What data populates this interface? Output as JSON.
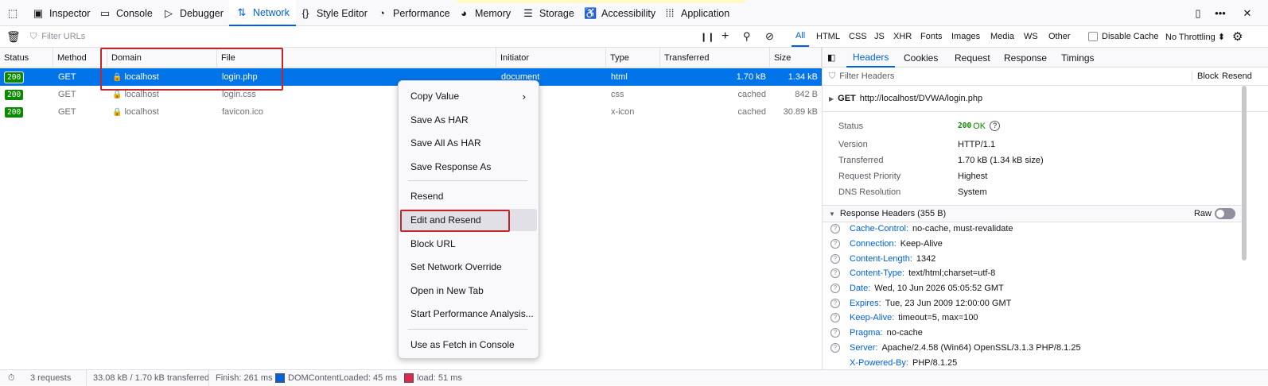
{
  "toolbar": {
    "tabs": [
      {
        "label": "Inspector",
        "icon": "inspector-icon"
      },
      {
        "label": "Console",
        "icon": "console-icon"
      },
      {
        "label": "Debugger",
        "icon": "debugger-icon"
      },
      {
        "label": "Network",
        "icon": "network-icon",
        "active": true
      },
      {
        "label": "Style Editor",
        "icon": "style-editor-icon"
      },
      {
        "label": "Performance",
        "icon": "performance-icon"
      },
      {
        "label": "Memory",
        "icon": "memory-icon"
      },
      {
        "label": "Storage",
        "icon": "storage-icon"
      },
      {
        "label": "Accessibility",
        "icon": "accessibility-icon"
      },
      {
        "label": "Application",
        "icon": "application-icon"
      }
    ]
  },
  "filterbar": {
    "placeholder": "Filter URLs",
    "types": [
      "All",
      "HTML",
      "CSS",
      "JS",
      "XHR",
      "Fonts",
      "Images",
      "Media",
      "WS",
      "Other"
    ],
    "active_type": "All",
    "disable_cache_label": "Disable Cache",
    "throttling_label": "No Throttling ⬍"
  },
  "request_table": {
    "columns": [
      "Status",
      "Method",
      "Domain",
      "File",
      "Initiator",
      "Type",
      "Transferred",
      "Size"
    ],
    "rows": [
      {
        "status": "200",
        "method": "GET",
        "domain": "localhost",
        "file": "login.php",
        "initiator": "document",
        "type": "html",
        "transferred": "1.70 kB",
        "size": "1.34 kB",
        "selected": true
      },
      {
        "status": "200",
        "method": "GET",
        "domain": "localhost",
        "file": "login.css",
        "initiator": "",
        "type": "css",
        "transferred": "cached",
        "size": "842 B"
      },
      {
        "status": "200",
        "method": "GET",
        "domain": "localhost",
        "file": "favicon.ico",
        "initiator": "",
        "type": "x-icon",
        "transferred": "cached",
        "size": "30.89 kB"
      }
    ]
  },
  "context_menu": {
    "items": [
      {
        "label": "Copy Value",
        "submenu": true
      },
      {
        "label": "Save As HAR"
      },
      {
        "label": "Save All As HAR"
      },
      {
        "label": "Save Response As"
      },
      {
        "label": "Resend"
      },
      {
        "label": "Edit and Resend",
        "highlighted": true
      },
      {
        "label": "Block URL"
      },
      {
        "label": "Set Network Override"
      },
      {
        "label": "Open in New Tab"
      },
      {
        "label": "Start Performance Analysis..."
      },
      {
        "label": "Use as Fetch in Console"
      }
    ]
  },
  "side_panel": {
    "tabs": [
      "Headers",
      "Cookies",
      "Request",
      "Response",
      "Timings"
    ],
    "active_tab": "Headers",
    "filter_placeholder": "Filter Headers",
    "block_label": "Block",
    "resend_label": "Resend",
    "request_line": {
      "method": "GET",
      "url": "http://localhost/DVWA/login.php"
    },
    "summary": [
      {
        "key": "Status",
        "value": "OK",
        "code": "200"
      },
      {
        "key": "Version",
        "value": "HTTP/1.1"
      },
      {
        "key": "Transferred",
        "value": "1.70 kB (1.34 kB size)"
      },
      {
        "key": "Request Priority",
        "value": "Highest"
      },
      {
        "key": "DNS Resolution",
        "value": "System"
      }
    ],
    "response_headers_title": "Response Headers (355 B)",
    "raw_label": "Raw",
    "response_headers": [
      {
        "name": "Cache-Control:",
        "value": "no-cache, must-revalidate"
      },
      {
        "name": "Connection:",
        "value": "Keep-Alive"
      },
      {
        "name": "Content-Length:",
        "value": "1342"
      },
      {
        "name": "Content-Type:",
        "value": "text/html;charset=utf-8"
      },
      {
        "name": "Date:",
        "value": "Wed, 10 Jun 2026 05:05:52 GMT"
      },
      {
        "name": "Expires:",
        "value": "Tue, 23 Jun 2009 12:00:00 GMT"
      },
      {
        "name": "Keep-Alive:",
        "value": "timeout=5, max=100"
      },
      {
        "name": "Pragma:",
        "value": "no-cache"
      },
      {
        "name": "Server:",
        "value": "Apache/2.4.58 (Win64) OpenSSL/3.1.3 PHP/8.1.25"
      },
      {
        "name": "X-Powered-By:",
        "value": "PHP/8.1.25"
      }
    ]
  },
  "statusbar": {
    "requests": "3 requests",
    "transferred": "33.08 kB / 1.70 kB transferred",
    "finish": "Finish: 261 ms",
    "domcontentloaded": "DOMContentLoaded: 45 ms",
    "load": "load: 51 ms"
  },
  "colors": {
    "accent": "#0061e0",
    "selected_row": "#0074e8",
    "status_ok": "#0b8a00",
    "highlight_box": "#c0272d"
  }
}
